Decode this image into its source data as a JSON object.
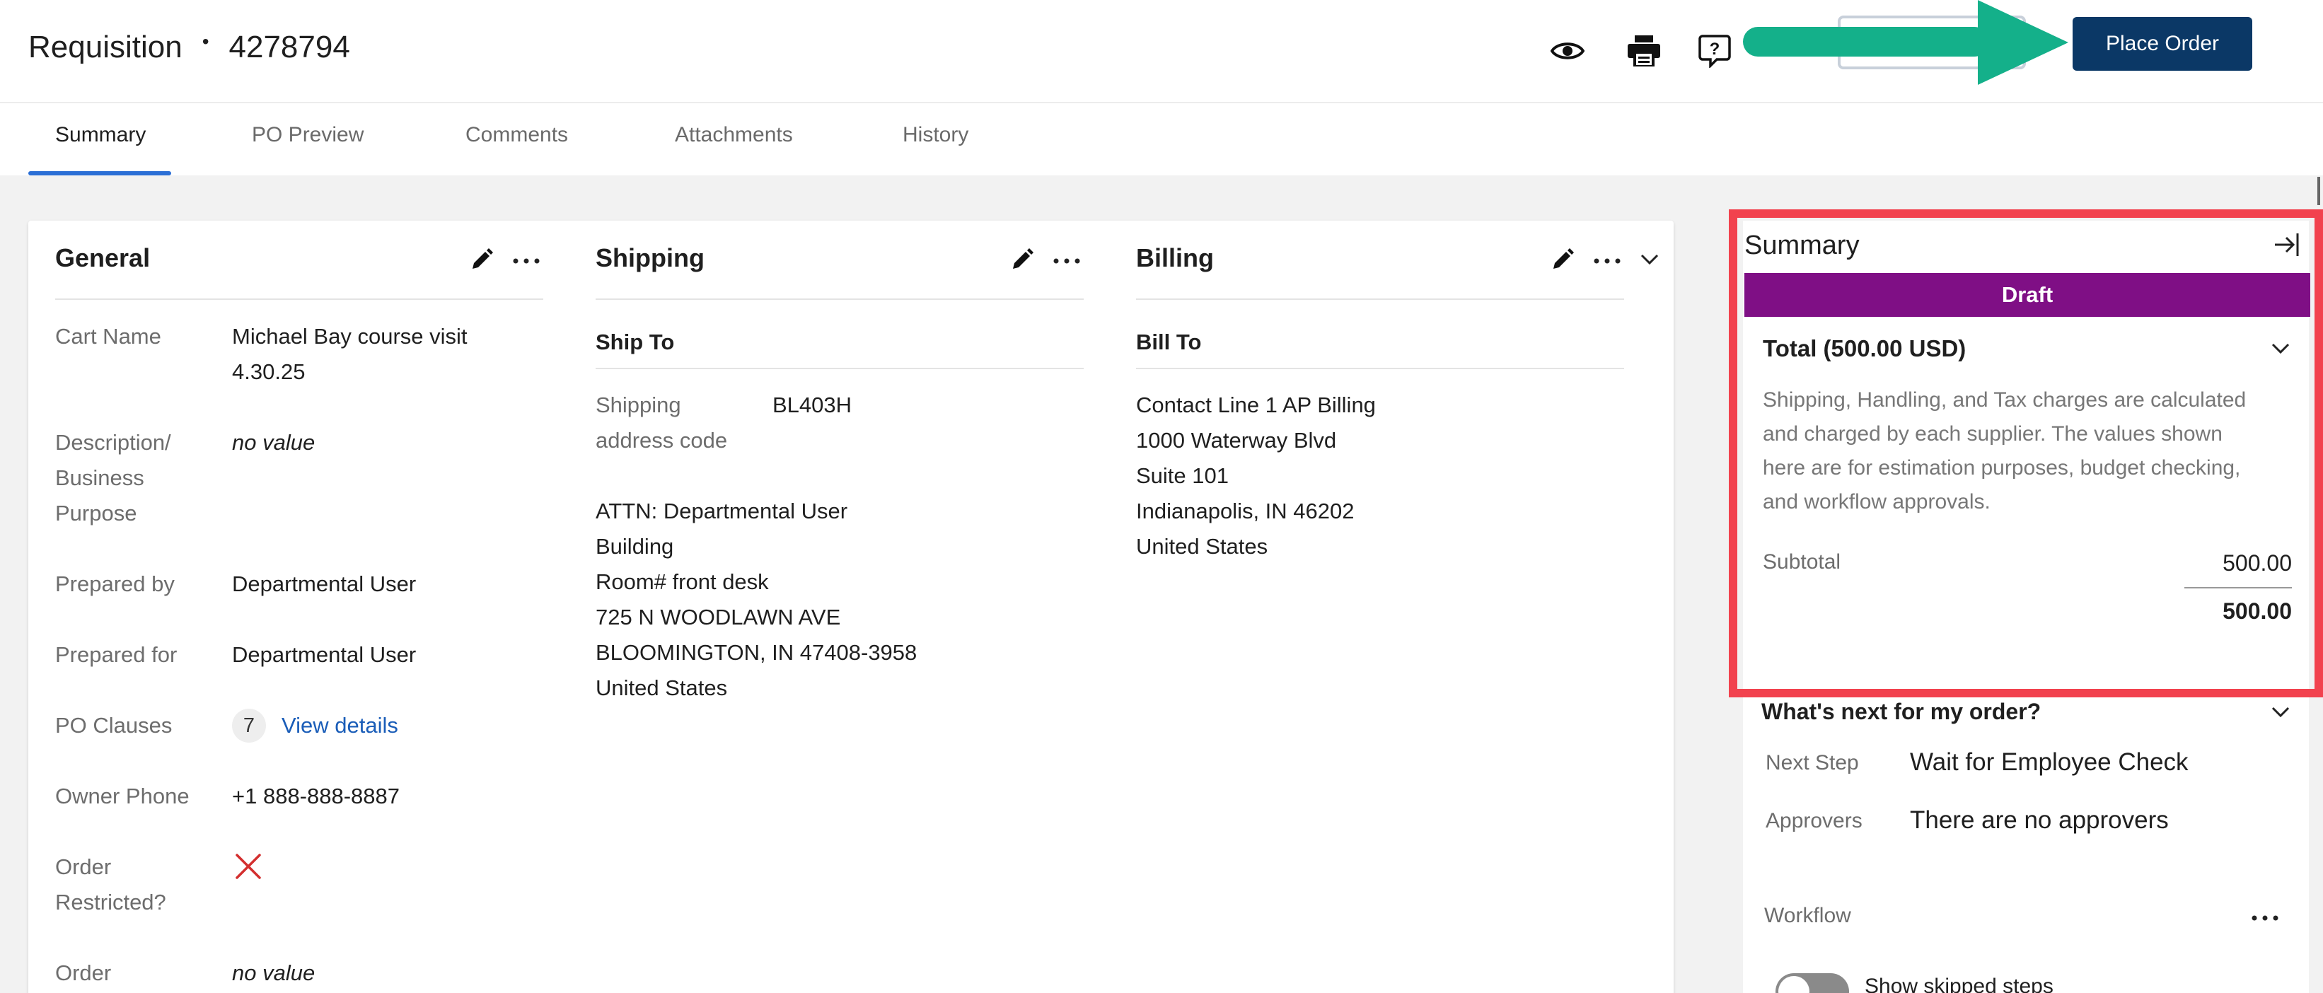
{
  "header": {
    "title": "Requisition",
    "separator": "•",
    "number": "4278794",
    "place_order_label": "Place Order"
  },
  "icons": [
    "eye-icon",
    "printer-icon",
    "help-icon"
  ],
  "colors": {
    "primary": "#0b3866",
    "tab_underline": "#2b6fd6",
    "draft": "#7f0f85",
    "highlight": "#f2424e",
    "arrow": "#14b08a",
    "link": "#1a5db8"
  },
  "tabs": [
    {
      "label": "Summary",
      "active": true
    },
    {
      "label": "PO Preview"
    },
    {
      "label": "Comments"
    },
    {
      "label": "Attachments"
    },
    {
      "label": "History"
    }
  ],
  "general": {
    "heading": "General",
    "cart_name_label": "Cart Name",
    "cart_name_line1": "Michael Bay course visit",
    "cart_name_line2": "4.30.25",
    "description_label_1": "Description/",
    "description_label_2": "Business",
    "description_label_3": "Purpose",
    "description_value": "no value",
    "prepared_by_label": "Prepared by",
    "prepared_by_value": "Departmental User",
    "prepared_for_label": "Prepared for",
    "prepared_for_value": "Departmental User",
    "po_clauses_label": "PO Clauses",
    "po_clauses_count": "7",
    "po_clauses_link": "View details",
    "owner_phone_label": "Owner Phone",
    "owner_phone_value": "+1 888-888-8887",
    "order_restricted_label_1": "Order",
    "order_restricted_label_2": "Restricted?",
    "order_label": "Order",
    "order_value": "no value"
  },
  "shipping": {
    "heading": "Shipping",
    "ship_to": "Ship To",
    "code_label_1": "Shipping",
    "code_label_2": "address code",
    "code_value": "BL403H",
    "address": [
      "ATTN: Departmental User",
      "Building",
      "Room# front desk",
      "725 N WOODLAWN AVE",
      "BLOOMINGTON, IN 47408-3958",
      "United States"
    ]
  },
  "billing": {
    "heading": "Billing",
    "bill_to": "Bill To",
    "address": [
      "Contact Line 1 AP Billing",
      "1000 Waterway Blvd",
      "Suite 101",
      "Indianapolis, IN 46202",
      "United States"
    ]
  },
  "summary": {
    "title": "Summary",
    "status": "Draft",
    "total_label": "Total (500.00 USD)",
    "notice_1": "Shipping, Handling, and Tax charges are calculated",
    "notice_2": "and charged by each supplier. The values shown",
    "notice_3": "here are for estimation purposes, budget checking,",
    "notice_4": "and workflow approvals.",
    "subtotal_label": "Subtotal",
    "subtotal_value": "500.00",
    "grand_total": "500.00",
    "next_heading": "What's next for my order?",
    "next_step_label": "Next Step",
    "next_step_value": "Wait for Employee Check",
    "approvers_label": "Approvers",
    "approvers_value": "There are no approvers",
    "workflow_label": "Workflow",
    "show_skipped_label": "Show skipped steps"
  }
}
